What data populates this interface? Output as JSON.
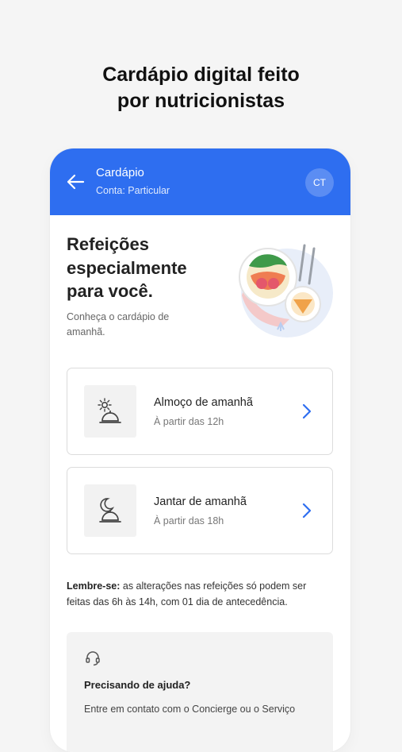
{
  "promo": {
    "line1": "Cardápio digital feito",
    "line2": "por nutricionistas"
  },
  "header": {
    "title": "Cardápio",
    "subtitle": "Conta: Particular",
    "avatar_initials": "CT",
    "color": "#2e6ef0"
  },
  "hero": {
    "title": "Refeições especialmente para você.",
    "subtitle": "Conheça o cardápio de amanhã."
  },
  "meals": [
    {
      "title": "Almoço de amanhã",
      "subtitle": "À partir das 12h",
      "icon": "sun-dish-icon"
    },
    {
      "title": "Jantar de amanhã",
      "subtitle": "À partir das 18h",
      "icon": "moon-dish-icon"
    }
  ],
  "reminder": {
    "label": "Lembre-se:",
    "text": " as alterações nas refeições só podem ser feitas das 6h às 14h, com 01 dia de antecedência."
  },
  "help": {
    "title": "Precisando de ajuda?",
    "text": "Entre em contato com o Concierge ou o Serviço",
    "icon": "headset-icon"
  }
}
